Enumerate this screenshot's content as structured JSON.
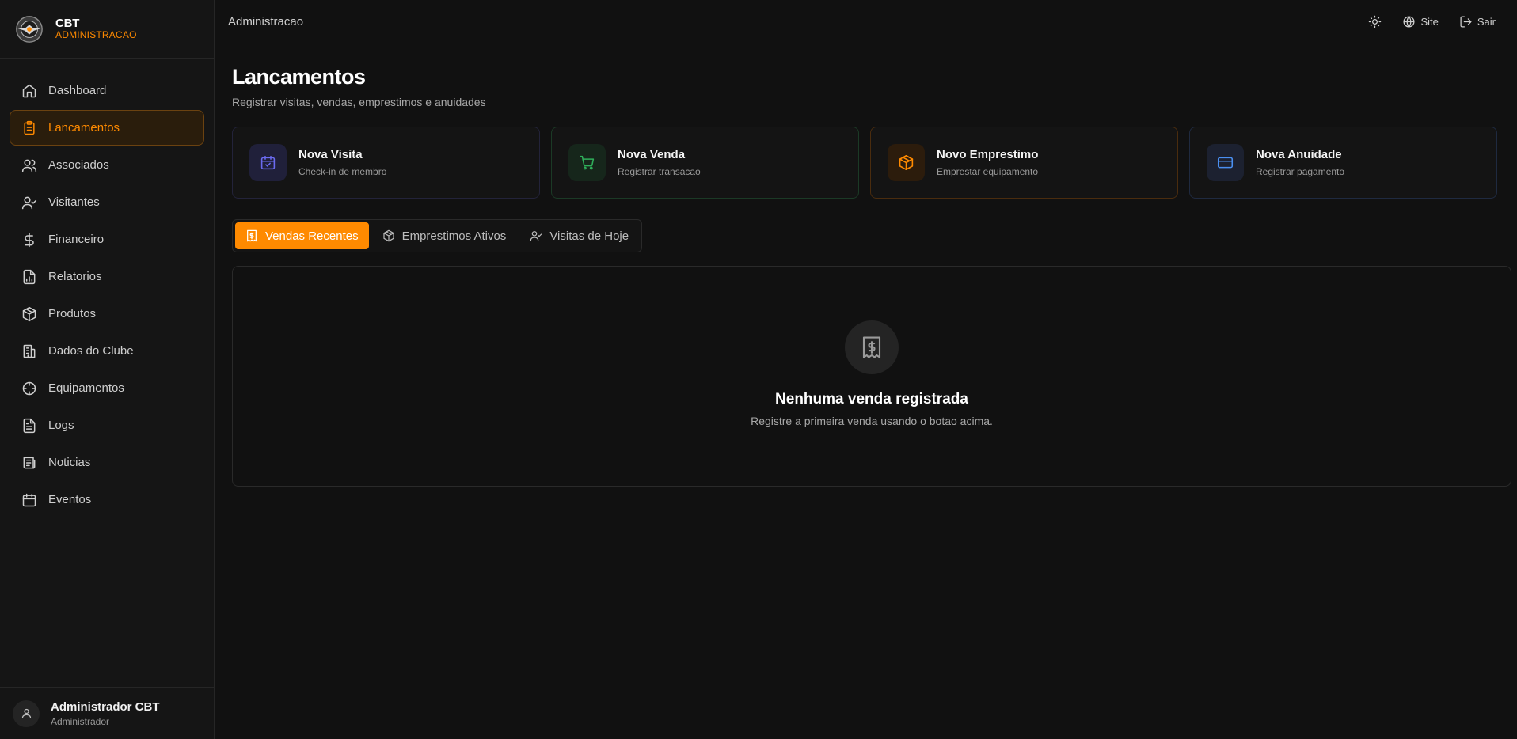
{
  "brand": {
    "name": "CBT",
    "subtitle": "ADMINISTRACAO"
  },
  "sidebar": {
    "items": [
      {
        "label": "Dashboard",
        "icon": "home-icon",
        "active": false
      },
      {
        "label": "Lancamentos",
        "icon": "clipboard-icon",
        "active": true
      },
      {
        "label": "Associados",
        "icon": "users-icon",
        "active": false
      },
      {
        "label": "Visitantes",
        "icon": "user-check-icon",
        "active": false
      },
      {
        "label": "Financeiro",
        "icon": "dollar-icon",
        "active": false
      },
      {
        "label": "Relatorios",
        "icon": "report-icon",
        "active": false
      },
      {
        "label": "Produtos",
        "icon": "package-icon",
        "active": false
      },
      {
        "label": "Dados do Clube",
        "icon": "building-icon",
        "active": false
      },
      {
        "label": "Equipamentos",
        "icon": "crosshair-icon",
        "active": false
      },
      {
        "label": "Logs",
        "icon": "file-text-icon",
        "active": false
      },
      {
        "label": "Noticias",
        "icon": "newspaper-icon",
        "active": false
      },
      {
        "label": "Eventos",
        "icon": "calendar-icon",
        "active": false
      }
    ]
  },
  "user": {
    "name": "Administrador CBT",
    "role": "Administrador"
  },
  "topbar": {
    "title": "Administracao",
    "site_label": "Site",
    "logout_label": "Sair"
  },
  "page": {
    "title": "Lancamentos",
    "subtitle": "Registrar visitas, vendas, emprestimos e anuidades"
  },
  "cards": [
    {
      "title": "Nova Visita",
      "subtitle": "Check-in de membro",
      "icon": "calendar-check-icon",
      "color": "#6b6bf0",
      "bg": "#20203a",
      "border": "#23233a"
    },
    {
      "title": "Nova Venda",
      "subtitle": "Registrar transacao",
      "icon": "cart-icon",
      "color": "#2fae5a",
      "bg": "#16261b",
      "border": "#1b3a26"
    },
    {
      "title": "Novo Emprestimo",
      "subtitle": "Emprestar equipamento",
      "icon": "package-icon",
      "color": "#ff8a00",
      "bg": "#2c1c0c",
      "border": "#4a2c0e"
    },
    {
      "title": "Nova Anuidade",
      "subtitle": "Registrar pagamento",
      "icon": "credit-card-icon",
      "color": "#4a8ff0",
      "bg": "#1c2130",
      "border": "#1f2a40"
    }
  ],
  "tabs": [
    {
      "label": "Vendas Recentes",
      "icon": "receipt-icon",
      "active": true
    },
    {
      "label": "Emprestimos Ativos",
      "icon": "package-icon",
      "active": false
    },
    {
      "label": "Visitas de Hoje",
      "icon": "user-check-icon",
      "active": false
    }
  ],
  "empty_state": {
    "title": "Nenhuma venda registrada",
    "subtitle": "Registre a primeira venda usando o botao acima.",
    "icon": "receipt-icon"
  },
  "colors": {
    "accent": "#ff8a00",
    "background": "#111111",
    "sidebar": "#151515"
  }
}
